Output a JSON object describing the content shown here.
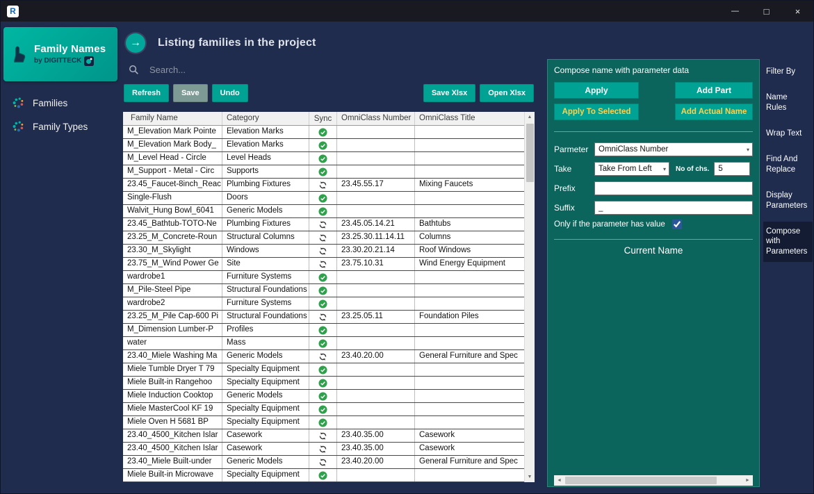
{
  "window": {
    "app_icon_letter": "R",
    "controls": {
      "minimize": "—",
      "maximize": "□",
      "close": "×"
    }
  },
  "icons": {
    "dropdown": "▾",
    "scroll_up": "▲",
    "scroll_down": "▼",
    "scroll_left": "◄",
    "scroll_right": "►",
    "header_arrow": "→"
  },
  "sidebar": {
    "title": "Family Names",
    "subtitle": "by DIGITTECK",
    "items": [
      {
        "label": "Families"
      },
      {
        "label": "Family Types"
      }
    ]
  },
  "header": {
    "title": "Listing families in the project"
  },
  "search": {
    "placeholder": "Search..."
  },
  "toolbar": {
    "left": [
      "Refresh",
      "Save",
      "Undo"
    ],
    "right": [
      "Save Xlsx",
      "Open Xlsx"
    ]
  },
  "table": {
    "columns": [
      "Family Name",
      "Category",
      "Sync",
      "OmniClass Number",
      "OmniClass Title"
    ],
    "rows": [
      {
        "family_name": "M_Elevation Mark Pointe",
        "category": "Elevation Marks",
        "sync": "check",
        "omni_number": "",
        "omni_title": ""
      },
      {
        "family_name": "M_Elevation Mark Body_",
        "category": "Elevation Marks",
        "sync": "check",
        "omni_number": "",
        "omni_title": ""
      },
      {
        "family_name": "M_Level Head - Circle",
        "category": "Level Heads",
        "sync": "check",
        "omni_number": "",
        "omni_title": ""
      },
      {
        "family_name": "M_Support - Metal - Circ",
        "category": "Supports",
        "sync": "check",
        "omni_number": "",
        "omni_title": ""
      },
      {
        "family_name": "23.45_Faucet-8inch_Reac",
        "category": "Plumbing Fixtures",
        "sync": "sync",
        "omni_number": "23.45.55.17",
        "omni_title": "Mixing Faucets"
      },
      {
        "family_name": "Single-Flush",
        "category": "Doors",
        "sync": "check",
        "omni_number": "",
        "omni_title": ""
      },
      {
        "family_name": "Walvit_Hung Bowl_6041",
        "category": "Generic Models",
        "sync": "check",
        "omni_number": "",
        "omni_title": ""
      },
      {
        "family_name": "23.45_Bathtub-TOTO-Ne",
        "category": "Plumbing Fixtures",
        "sync": "sync",
        "omni_number": "23.45.05.14.21",
        "omni_title": "Bathtubs"
      },
      {
        "family_name": "23.25_M_Concrete-Roun",
        "category": "Structural Columns",
        "sync": "sync",
        "omni_number": "23.25.30.11.14.11",
        "omni_title": "Columns"
      },
      {
        "family_name": "23.30_M_Skylight",
        "category": "Windows",
        "sync": "sync",
        "omni_number": "23.30.20.21.14",
        "omni_title": "Roof Windows"
      },
      {
        "family_name": "23.75_M_Wind Power Ge",
        "category": "Site",
        "sync": "sync",
        "omni_number": "23.75.10.31",
        "omni_title": "Wind Energy Equipment"
      },
      {
        "family_name": "wardrobe1",
        "category": "Furniture Systems",
        "sync": "check",
        "omni_number": "",
        "omni_title": ""
      },
      {
        "family_name": "M_Pile-Steel Pipe",
        "category": "Structural Foundations",
        "sync": "check",
        "omni_number": "",
        "omni_title": ""
      },
      {
        "family_name": "wardrobe2",
        "category": "Furniture Systems",
        "sync": "check",
        "omni_number": "",
        "omni_title": ""
      },
      {
        "family_name": "23.25_M_Pile Cap-600 Pi",
        "category": "Structural Foundations",
        "sync": "sync",
        "omni_number": "23.25.05.11",
        "omni_title": "Foundation Piles"
      },
      {
        "family_name": "M_Dimension Lumber-P",
        "category": "Profiles",
        "sync": "check",
        "omni_number": "",
        "omni_title": ""
      },
      {
        "family_name": "water",
        "category": "Mass",
        "sync": "check",
        "omni_number": "",
        "omni_title": ""
      },
      {
        "family_name": "23.40_Miele Washing Ma",
        "category": "Generic Models",
        "sync": "sync",
        "omni_number": "23.40.20.00",
        "omni_title": "General Furniture and Spec"
      },
      {
        "family_name": "Miele Tumble Dryer T 79",
        "category": "Specialty Equipment",
        "sync": "check",
        "omni_number": "",
        "omni_title": ""
      },
      {
        "family_name": "Miele Built-in Rangehoo",
        "category": "Specialty Equipment",
        "sync": "check",
        "omni_number": "",
        "omni_title": ""
      },
      {
        "family_name": "Miele Induction Cooktop",
        "category": "Generic Models",
        "sync": "check",
        "omni_number": "",
        "omni_title": ""
      },
      {
        "family_name": "Miele MasterCool KF 19",
        "category": "Specialty Equipment",
        "sync": "check",
        "omni_number": "",
        "omni_title": ""
      },
      {
        "family_name": "Miele Oven H 5681 BP",
        "category": "Specialty Equipment",
        "sync": "check",
        "omni_number": "",
        "omni_title": ""
      },
      {
        "family_name": "23.40_4500_Kitchen Islar",
        "category": "Casework",
        "sync": "sync",
        "omni_number": "23.40.35.00",
        "omni_title": "Casework"
      },
      {
        "family_name": "23.40_4500_Kitchen Islar",
        "category": "Casework",
        "sync": "sync",
        "omni_number": "23.40.35.00",
        "omni_title": "Casework"
      },
      {
        "family_name": "23.40_Miele Built-under",
        "category": "Generic Models",
        "sync": "sync",
        "omni_number": "23.40.20.00",
        "omni_title": "General Furniture and Spec"
      },
      {
        "family_name": "Miele Built-in Microwave",
        "category": "Specialty Equipment",
        "sync": "check",
        "omni_number": "",
        "omni_title": ""
      }
    ]
  },
  "compose_panel": {
    "title": "Compose name with parameter data",
    "buttons": {
      "apply": "Apply",
      "add_part": "Add Part",
      "apply_to_selected": "Apply To Selected",
      "add_actual_name": "Add Actual Name"
    },
    "fields": {
      "parameter_label": "Parmeter",
      "parameter_value": "OmniClass Number",
      "take_label": "Take",
      "take_value": "Take From Left",
      "no_of_chs_label": "No of chs.",
      "no_of_chs_value": "5",
      "prefix_label": "Prefix",
      "prefix_value": "",
      "suffix_label": "Suffix",
      "suffix_value": "_",
      "only_if_label": "Only if the parameter has value",
      "only_if_checked": true
    },
    "current_name_label": "Current Name"
  },
  "tabs": {
    "items": [
      {
        "label": "Filter By",
        "active": false
      },
      {
        "label": "Name Rules",
        "active": false
      },
      {
        "label": "Wrap Text",
        "active": false
      },
      {
        "label": "Find And Replace",
        "active": false
      },
      {
        "label": "Display Parameters",
        "active": false
      },
      {
        "label": "Compose with Parameters",
        "active": true
      }
    ]
  },
  "colors": {
    "accent_teal": "#00a294",
    "panel_teal": "#0c655c",
    "navy_background": "#1f2c4e",
    "titlebar": "#191a21",
    "yellow_button_text": "#ffd24d",
    "green_check": "#2fa14c",
    "active_tab": "#131c33"
  }
}
